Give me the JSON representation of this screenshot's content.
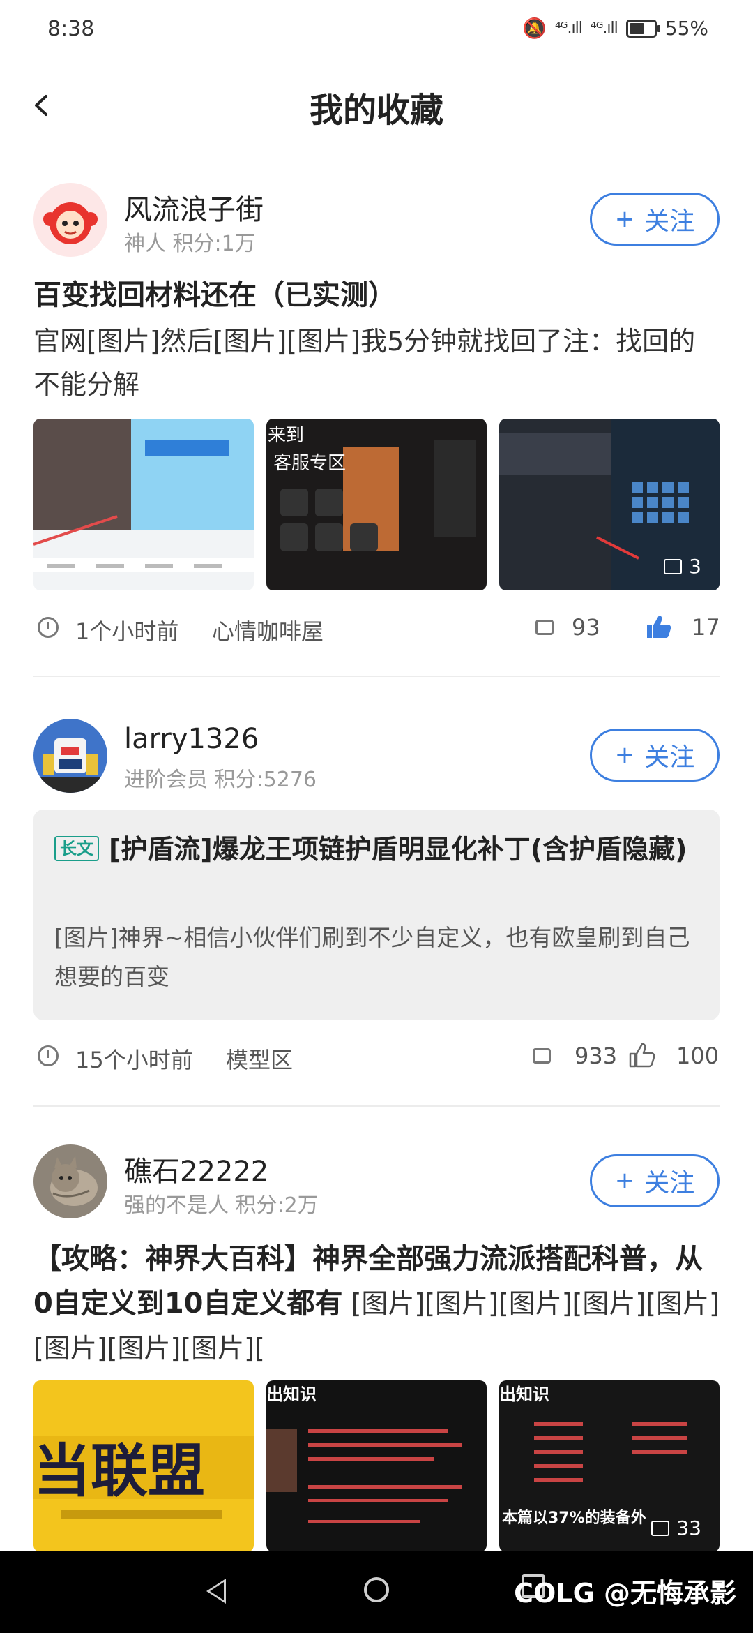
{
  "status_bar": {
    "time": "8:38",
    "signal1": "⁴ᴳ.ıll",
    "signal2": "⁴ᴳ.ıll",
    "battery": "55%"
  },
  "header": {
    "title": "我的收藏"
  },
  "posts": [
    {
      "author": "风流浪子街",
      "meta": "神人  积分:1万",
      "follow": "关注",
      "title": "百变找回材料还在（已实测）",
      "body": " 官网[图片]然后[图片][图片]我5分钟就找回了注：找回的不能分解",
      "image_count": "3",
      "time": "1个小时前",
      "forum": "心情咖啡屋",
      "comments": "93",
      "likes": "17",
      "liked": true,
      "img_texts": [
        "",
        "来到",
        "客服专区"
      ]
    },
    {
      "author": "larry1326",
      "meta": "进阶会员  积分:5276",
      "follow": "关注",
      "tag": "长文",
      "title": "[护盾流]爆龙王项链护盾明显化补丁(含护盾隐藏)",
      "body": " [图片]神界~相信小伙伴们刷到不少自定义，也有欧皇刷到自己想要的百变",
      "time": "15个小时前",
      "forum": "模型区",
      "comments": "933",
      "likes": "100",
      "liked": false
    },
    {
      "author": "礁石22222",
      "meta": "强的不是人  积分:2万",
      "follow": "关注",
      "title": "【攻略：神界大百科】神界全部强力流派搭配科普，从0自定义到10自定义都有",
      "body": "     [图片][图片][图片][图片][图片][图片][图片][图片][",
      "image_count": "33",
      "img_texts": [
        "当联盟",
        "出知识",
        "本篇以37%的装备外"
      ]
    }
  ],
  "watermark": "COLG @无悔承影",
  "colors": {
    "accent": "#3d7fe0",
    "tag": "#1a9e8a",
    "like_active": "#3d7fe0"
  }
}
